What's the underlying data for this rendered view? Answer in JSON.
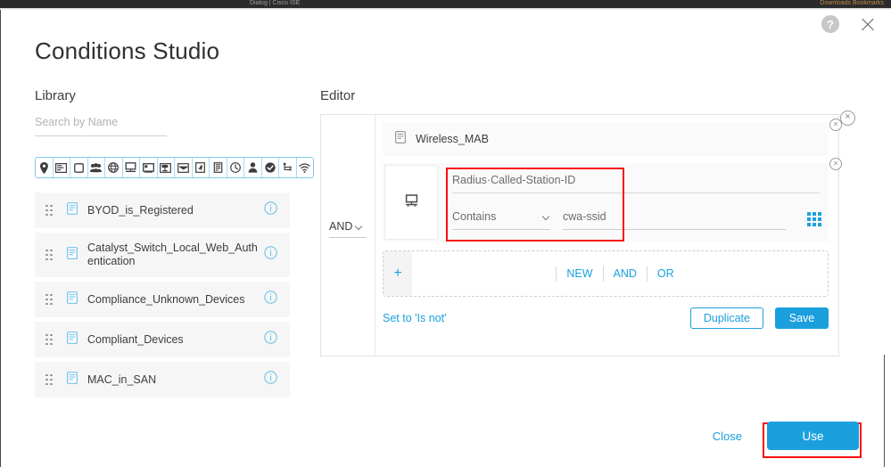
{
  "browser": {
    "tab_ghost": "Dialog | Cisco ISE",
    "tab_ghost_right": "Downloads  Bookmarks"
  },
  "window": {
    "help_icon": "help-icon",
    "help_glyph": "?",
    "close_icon": "close-icon"
  },
  "title": "Conditions Studio",
  "sections": {
    "library_heading": "Library",
    "editor_heading": "Editor"
  },
  "search": {
    "placeholder": "Search by Name",
    "value": ""
  },
  "filter_icons": [
    {
      "name": "location-pin-icon",
      "glyph": "pin"
    },
    {
      "name": "window-card-icon",
      "glyph": "window"
    },
    {
      "name": "square-outline-icon",
      "glyph": "square"
    },
    {
      "name": "group-users-icon",
      "glyph": "group"
    },
    {
      "name": "globe-icon",
      "glyph": "globe"
    },
    {
      "name": "network-device-icon",
      "glyph": "netdev"
    },
    {
      "name": "desktop-icon",
      "glyph": "desktop"
    },
    {
      "name": "printer-icon",
      "glyph": "printer"
    },
    {
      "name": "mail-icon",
      "glyph": "mail"
    },
    {
      "name": "certificate-icon",
      "glyph": "cert"
    },
    {
      "name": "server-icon",
      "glyph": "server"
    },
    {
      "name": "clock-icon",
      "glyph": "clock"
    },
    {
      "name": "person-icon",
      "glyph": "person"
    },
    {
      "name": "check-circle-icon",
      "glyph": "check"
    },
    {
      "name": "topology-icon",
      "glyph": "topology"
    },
    {
      "name": "wifi-icon",
      "glyph": "wifi"
    }
  ],
  "library_items": [
    {
      "label": "BYOD_is_Registered",
      "tall": false
    },
    {
      "label": "Catalyst_Switch_Local_Web_Authentication",
      "tall": true
    },
    {
      "label": "Compliance_Unknown_Devices",
      "tall": false
    },
    {
      "label": "Compliant_Devices",
      "tall": false
    },
    {
      "label": "MAC_in_SAN",
      "tall": false
    }
  ],
  "editor": {
    "logic_operator": "AND",
    "rule_name": "Wireless_MAB",
    "condition": {
      "attribute": "Radius·Called-Station-ID",
      "operator": "Contains",
      "value": "cwa-ssid"
    },
    "add_row": {
      "plus": "+",
      "ops": [
        "NEW",
        "AND",
        "OR"
      ]
    },
    "set_is_not": "Set to 'Is not'",
    "duplicate_label": "Duplicate",
    "save_label": "Save"
  },
  "dialog": {
    "close_label": "Close",
    "use_label": "Use"
  },
  "colors": {
    "accent_blue": "#1ba0dd",
    "annotation_red": "#fb0d0d",
    "panel_grey": "#f6f6f6",
    "text_dark": "#3d3d3d"
  }
}
